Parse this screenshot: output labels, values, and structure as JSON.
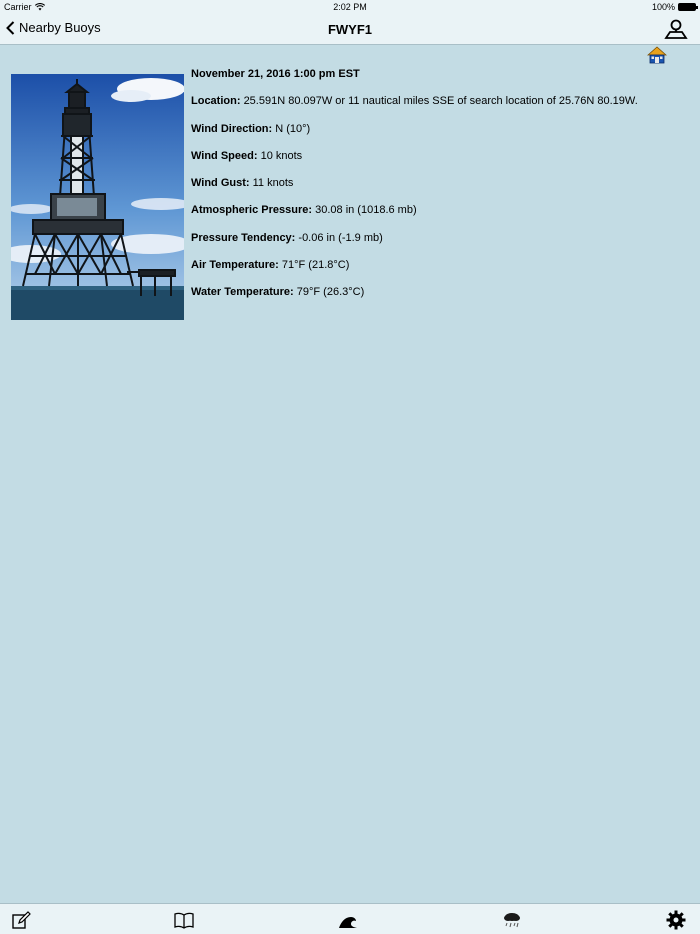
{
  "status_bar": {
    "carrier": "Carrier",
    "time": "2:02 PM",
    "battery": "100%"
  },
  "nav": {
    "back_label": "Nearby Buoys",
    "title": "FWYF1",
    "right_icon": "person-location-icon"
  },
  "observation": {
    "datetime": "November 21, 2016 1:00 pm EST",
    "fields": [
      {
        "label": "Location:",
        "value": "25.591N 80.097W or 11 nautical miles SSE of search location of 25.76N 80.19W."
      },
      {
        "label": "Wind Direction:",
        "value": "N (10°)"
      },
      {
        "label": "Wind Speed:",
        "value": "10 knots"
      },
      {
        "label": "Wind Gust:",
        "value": "11 knots"
      },
      {
        "label": "Atmospheric Pressure:",
        "value": "30.08 in (1018.6 mb)"
      },
      {
        "label": "Pressure Tendency:",
        "value": "-0.06 in (-1.9 mb)"
      },
      {
        "label": "Air Temperature:",
        "value": "71°F (21.8°C)"
      },
      {
        "label": "Water Temperature:",
        "value": "79°F (26.3°C)"
      }
    ]
  },
  "tabs": [
    {
      "name": "edit-icon"
    },
    {
      "name": "book-icon"
    },
    {
      "name": "wave-icon"
    },
    {
      "name": "storm-cloud-icon"
    },
    {
      "name": "gear-icon"
    }
  ],
  "colors": {
    "background": "#c3dce4",
    "bar": "#eaf3f6"
  }
}
